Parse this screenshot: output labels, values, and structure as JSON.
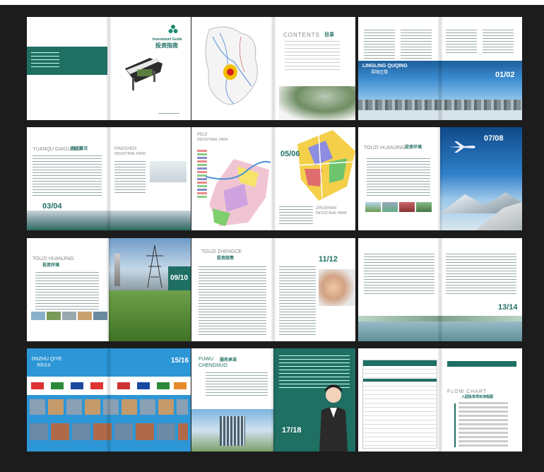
{
  "spread1": {
    "investment_guide": "Investment Guide",
    "title_cn": "投资指南"
  },
  "spread2": {
    "contents_title": "CONTENTS",
    "contents_cn": "目录"
  },
  "spread3": {
    "title": "LINGLING QUQING",
    "subtitle_cn": "零陵区情",
    "page_num": "01/02"
  },
  "spread4": {
    "title_left": "YUANQU GAIGUANG",
    "title_left_cn": "园区概况",
    "page_num": "03/04",
    "park_title": "PINGSHEN",
    "park_sub": "INDUSTRIAL PARK"
  },
  "spread5": {
    "title_top": "PEIJI",
    "title_sub": "INDUSTRIAL PARK",
    "page_num": "05/06",
    "title_bottom": "ZHUSHAN",
    "title_bottom_sub": "INDUSTRIAL PARK"
  },
  "spread6": {
    "title": "TOUZI HUANJING",
    "subtitle_cn": "投资环境",
    "page_num": "07/08"
  },
  "spread7": {
    "title": "TOUZI HUANJING",
    "subtitle_cn": "投资环境",
    "page_num": "09/10"
  },
  "spread8": {
    "title": "TOUZI ZHENGCE",
    "subtitle_cn": "投资政策",
    "page_num": "11/12"
  },
  "spread9": {
    "page_num": "13/14"
  },
  "spread10": {
    "title": "JINZHU QIYE",
    "subtitle_cn": "进驻企业",
    "page_num": "15/16",
    "logo_row": [
      "",
      "",
      "",
      "",
      "",
      "",
      "",
      ""
    ]
  },
  "spread11": {
    "title": "FUWU",
    "title2": "CHENGNUO",
    "subtitle_cn": "服务承诺",
    "page_num": "17/18"
  },
  "spread12": {
    "title": "FLOW CHART",
    "subtitle_cn": "入园投资项目流程图"
  }
}
